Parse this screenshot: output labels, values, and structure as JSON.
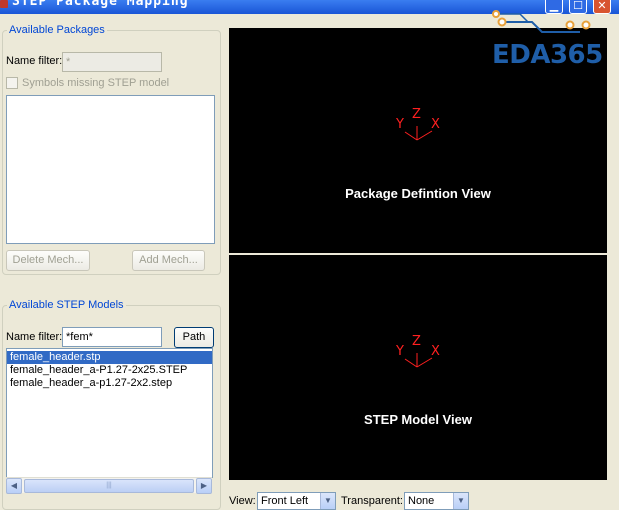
{
  "window": {
    "title": "STEP Package Mapping",
    "min_glyph": "▁",
    "max_glyph": "☐",
    "close_glyph": "✕"
  },
  "watermark": {
    "text": "EDA365"
  },
  "packages": {
    "legend": "Available Packages",
    "filter_label": "Name filter:",
    "filter_value": "*",
    "missing_checkbox_label": "Symbols missing STEP model",
    "delete_button": "Delete Mech...",
    "add_button": "Add Mech..."
  },
  "models": {
    "legend": "Available STEP Models",
    "filter_label": "Name filter:",
    "filter_value": "*fem*",
    "path_button": "Path",
    "items": [
      {
        "name": "female_header.stp",
        "selected": true
      },
      {
        "name": "female_header_a-P1.27-2x25.STEP",
        "selected": false
      },
      {
        "name": "female_header_a-p1.27-2x2.step",
        "selected": false
      }
    ],
    "scroll_left": "◀",
    "scroll_right": "▶",
    "scroll_thumb": "|||"
  },
  "views": {
    "package_caption": "Package Defintion View",
    "step_caption": "STEP Model View",
    "axis_x": "X",
    "axis_y": "Y",
    "axis_z": "Z"
  },
  "bottom_bar": {
    "view_label": "View:",
    "view_value": "Front Left",
    "transparent_label": "Transparent:",
    "transparent_value": "None"
  },
  "colors": {
    "accent": "#0046d5",
    "selection": "#316ac5",
    "axis": "#ff2020",
    "brand": "#1f5ea8",
    "viewport": "#000000"
  }
}
